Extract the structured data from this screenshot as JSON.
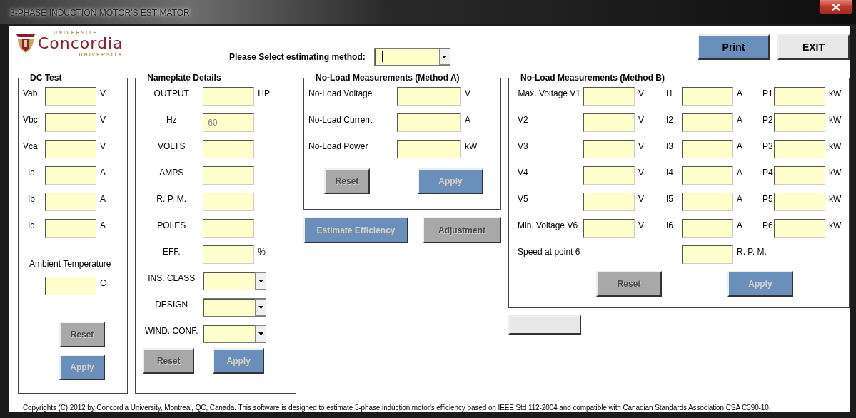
{
  "window": {
    "title": "3-PHASE INDUCTION MOTOR'S ESTIMATOR"
  },
  "logo": {
    "top_line": "UNIVERSITE",
    "name": "Concordia",
    "bottom_line": "UNIVERSITY"
  },
  "method": {
    "label": "Please Select estimating method:",
    "focused": true
  },
  "top_buttons": [
    {
      "label": "Print",
      "kind": "blue",
      "disabled": false
    },
    {
      "label": "EXIT",
      "kind": "plain",
      "disabled": false
    }
  ],
  "dc_test": {
    "title": "DC Test",
    "fields": [
      {
        "label": "Vab",
        "unit": "V"
      },
      {
        "label": "Vbc",
        "unit": "V"
      },
      {
        "label": "Vca",
        "unit": "V"
      },
      {
        "label": "Ia",
        "unit": "A"
      },
      {
        "label": "Ib",
        "unit": "A"
      },
      {
        "label": "Ic",
        "unit": "A"
      }
    ],
    "ambient": {
      "label": "Ambient Temperature",
      "unit": "C"
    },
    "buttons": [
      {
        "label": "Reset",
        "kind": "gray",
        "disabled": true
      },
      {
        "label": "Apply",
        "kind": "blue",
        "disabled": true
      }
    ]
  },
  "nameplate": {
    "title": "Nameplate Details",
    "fields": [
      {
        "label": "OUTPUT",
        "unit": "HP",
        "kind": "text"
      },
      {
        "label": "Hz",
        "value": "60",
        "kind": "text"
      },
      {
        "label": "VOLTS",
        "kind": "text"
      },
      {
        "label": "AMPS",
        "kind": "text"
      },
      {
        "label": "R. P. M.",
        "kind": "text"
      },
      {
        "label": "POLES",
        "kind": "text"
      },
      {
        "label": "EFF.",
        "unit": "%",
        "kind": "text"
      },
      {
        "label": "INS. CLASS",
        "kind": "dropdown"
      },
      {
        "label": "DESIGN",
        "kind": "dropdown"
      },
      {
        "label": "WIND. CONF.",
        "kind": "dropdown"
      }
    ],
    "buttons": [
      {
        "label": "Reset",
        "kind": "gray",
        "disabled": true
      },
      {
        "label": "Apply",
        "kind": "blue",
        "disabled": true
      }
    ]
  },
  "method_a": {
    "title": "No-Load Measurements (Method A)",
    "fields": [
      {
        "label": "No-Load Voltage",
        "unit": "V"
      },
      {
        "label": "No-Load Current",
        "unit": "A"
      },
      {
        "label": "No-Load Power",
        "unit": "kW"
      }
    ],
    "buttons": [
      {
        "label": "Reset",
        "kind": "gray",
        "disabled": true
      },
      {
        "label": "Apply",
        "kind": "blue",
        "disabled": true
      }
    ]
  },
  "actions": [
    {
      "label": "Estimate Efficiency",
      "kind": "blue",
      "disabled": true
    },
    {
      "label": "Adjustment",
      "kind": "gray",
      "disabled": true
    }
  ],
  "method_b": {
    "title": "No-Load Measurements (Method B)",
    "rows": [
      {
        "cells": [
          {
            "label": "Max. Voltage V1",
            "unit": "V"
          },
          {
            "label": "I1",
            "unit": "A"
          },
          {
            "label": "P1",
            "unit": "kW"
          }
        ]
      },
      {
        "cells": [
          {
            "label": "V2",
            "unit": "V"
          },
          {
            "label": "I2",
            "unit": "A"
          },
          {
            "label": "P2",
            "unit": "kW"
          }
        ]
      },
      {
        "cells": [
          {
            "label": "V3",
            "unit": "V"
          },
          {
            "label": "I3",
            "unit": "A"
          },
          {
            "label": "P3",
            "unit": "kW"
          }
        ]
      },
      {
        "cells": [
          {
            "label": "V4",
            "unit": "V"
          },
          {
            "label": "I4",
            "unit": "A"
          },
          {
            "label": "P4",
            "unit": "kW"
          }
        ]
      },
      {
        "cells": [
          {
            "label": "V5",
            "unit": "V"
          },
          {
            "label": "I5",
            "unit": "A"
          },
          {
            "label": "P5",
            "unit": "kW"
          }
        ]
      },
      {
        "cells": [
          {
            "label": "Min. Voltage V6",
            "unit": "V"
          },
          {
            "label": "I6",
            "unit": "A"
          },
          {
            "label": "P6",
            "unit": "kW"
          }
        ]
      }
    ],
    "speed": {
      "label": "Speed at point 6",
      "unit": "R. P. M."
    },
    "buttons": [
      {
        "label": "Reset",
        "kind": "gray",
        "disabled": true
      },
      {
        "label": "Apply",
        "kind": "blue",
        "disabled": true
      }
    ]
  },
  "extra_button": {
    "kind": "plain"
  },
  "footer": "Copyrights (C) 2012 by Concordia University, Montreal, QC, Canada. This software is designed to estimate 3-phase induction motor's efficiency based on IEEE Std 112-2004 and compatible with Canadian Standards Association CSA C390-10."
}
